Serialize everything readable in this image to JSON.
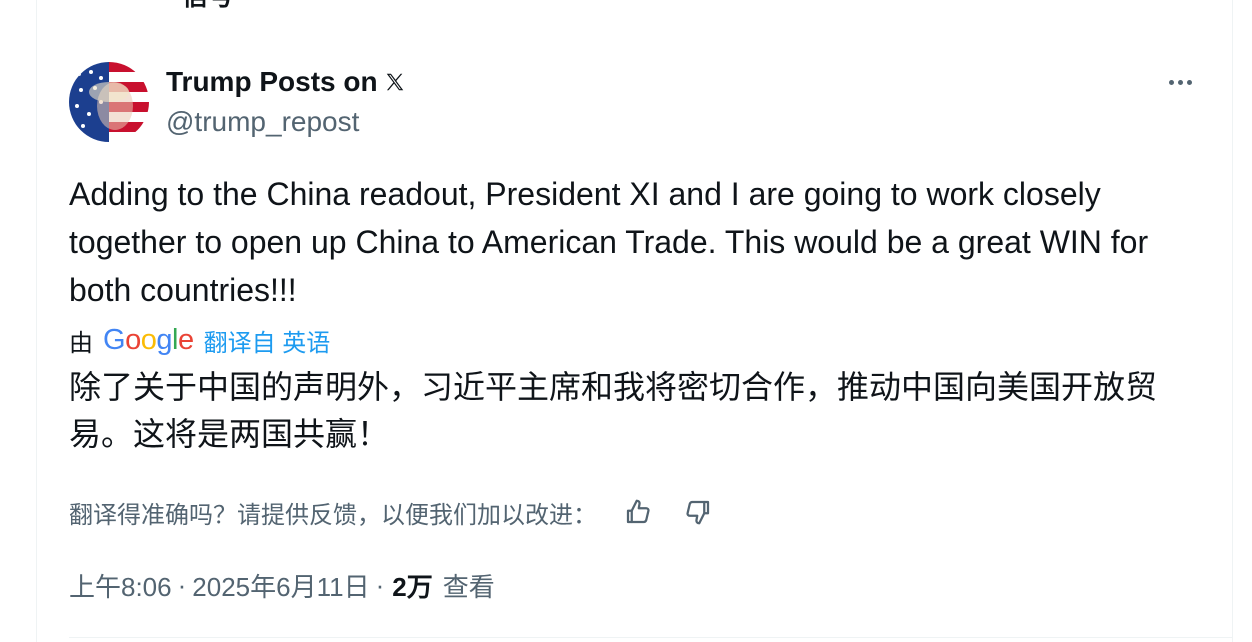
{
  "top_cut_text": "信号",
  "author": {
    "name": "Trump Posts on",
    "platform_icon": "x-logo-icon",
    "handle": "@trump_repost",
    "avatar_colors": [
      "#1c3f8f",
      "#c8102e",
      "#ffffff"
    ]
  },
  "tweet": {
    "text": "Adding to the China readout, President XI and I are going to work closely together to open up China to American Trade. This would be a great WIN for both countries!!!"
  },
  "translation": {
    "by_label": "由",
    "provider": "Google",
    "provider_letters": [
      {
        "ch": "G",
        "color": "#4285F4"
      },
      {
        "ch": "o",
        "color": "#EA4335"
      },
      {
        "ch": "o",
        "color": "#FBBC05"
      },
      {
        "ch": "g",
        "color": "#4285F4"
      },
      {
        "ch": "l",
        "color": "#34A853"
      },
      {
        "ch": "e",
        "color": "#EA4335"
      }
    ],
    "from_label": "翻译自 英语",
    "text": "除了关于中国的声明外，习近平主席和我将密切合作，推动中国向美国开放贸易。这将是两国共赢！",
    "feedback_prompt": "翻译得准确吗？请提供反馈，以便我们加以改进：",
    "thumb_up_icon": "thumbs-up-icon",
    "thumb_down_icon": "thumbs-down-icon"
  },
  "meta": {
    "time": "上午8:06",
    "separator": "·",
    "date": "2025年6月11日",
    "views_count": "2万",
    "views_label": "查看"
  },
  "colors": {
    "accent": "#1d9bf0",
    "secondary_text": "#536471",
    "primary_text": "#0f1419"
  }
}
